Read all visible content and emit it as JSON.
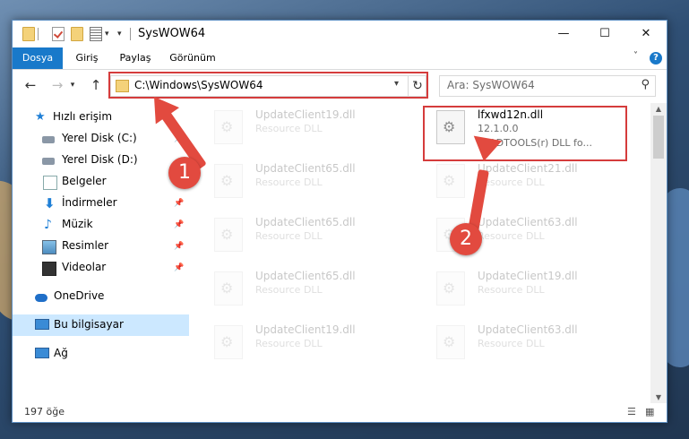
{
  "window": {
    "title": "SysWOW64"
  },
  "ribbon": {
    "tabs": [
      "Dosya",
      "Giriş",
      "Paylaş",
      "Görünüm"
    ],
    "help": "?"
  },
  "address": {
    "path": "C:\\Windows\\SysWOW64"
  },
  "search": {
    "placeholder": "Ara: SysWOW64"
  },
  "sidebar": {
    "items": [
      {
        "label": "Hızlı erişim"
      },
      {
        "label": "Yerel Disk (C:)"
      },
      {
        "label": "Yerel Disk (D:)"
      },
      {
        "label": "Belgeler"
      },
      {
        "label": "İndirmeler"
      },
      {
        "label": "Müzik"
      },
      {
        "label": "Resimler"
      },
      {
        "label": "Videolar"
      },
      {
        "label": "OneDrive"
      },
      {
        "label": "Bu bilgisayar"
      },
      {
        "label": "Ağ"
      }
    ]
  },
  "files": [
    {
      "name": "UpdateClient19.dll",
      "type": "Resource DLL"
    },
    {
      "name": "lfxwd12n.dll",
      "version": "12.1.0.0",
      "desc": "LEADTOOLS(r) DLL fo..."
    },
    {
      "name": "UpdateClient65.dll",
      "type": "Resource DLL"
    },
    {
      "name": "UpdateClient21.dll",
      "type": "Resource DLL"
    },
    {
      "name": "UpdateClient65.dll",
      "type": "Resource DLL"
    },
    {
      "name": "UpdateClient63.dll",
      "type": "Resource DLL"
    },
    {
      "name": "UpdateClient65.dll",
      "type": "Resource DLL"
    },
    {
      "name": "UpdateClient19.dll",
      "type": "Resource DLL"
    },
    {
      "name": "UpdateClient19.dll",
      "type": "Resource DLL"
    },
    {
      "name": "UpdateClient63.dll",
      "type": "Resource DLL"
    }
  ],
  "status": {
    "count": "197 öğe"
  },
  "annotations": {
    "badge1": "1",
    "badge2": "2",
    "color": "#e24a3f"
  }
}
